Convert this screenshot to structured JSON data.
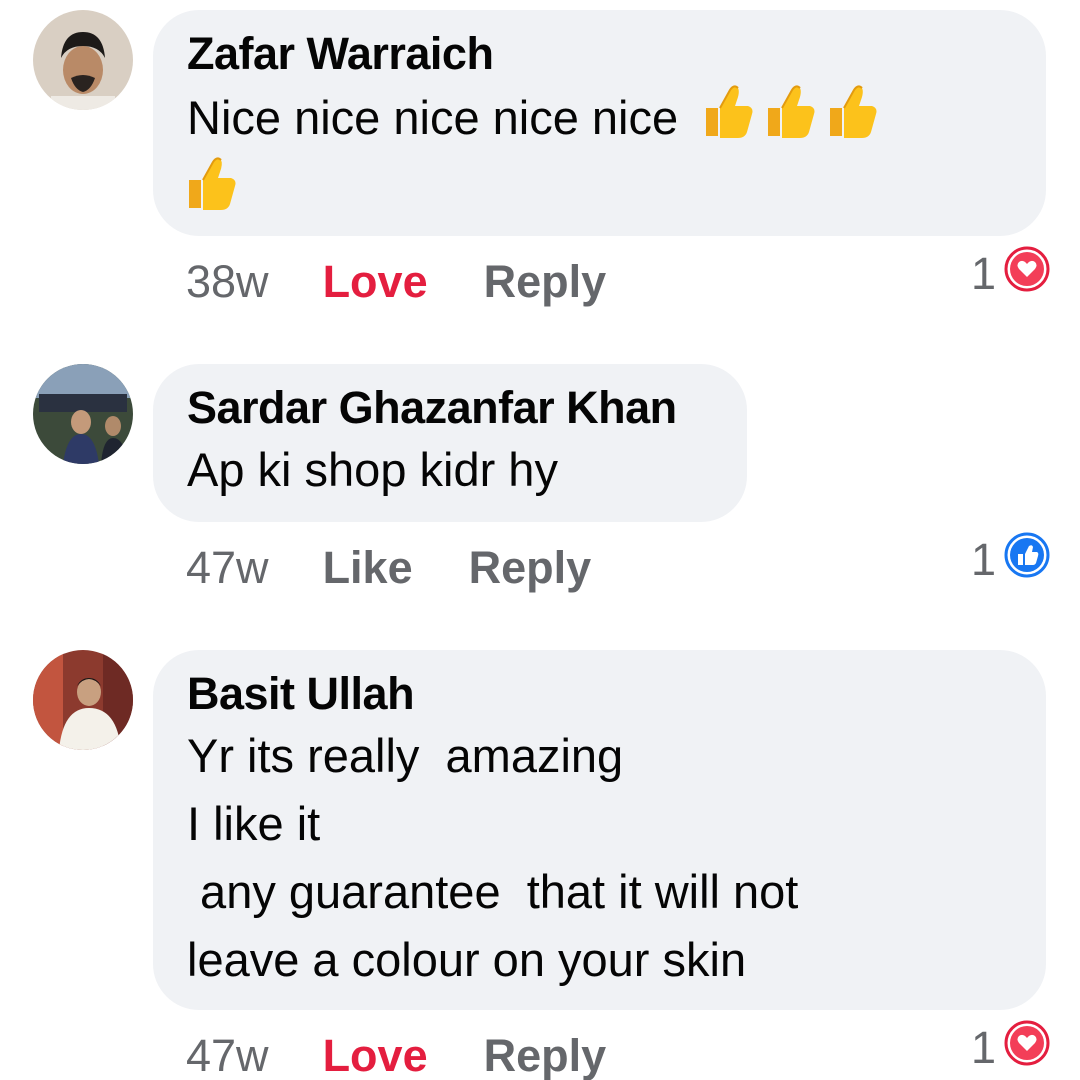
{
  "comments": [
    {
      "author": "Zafar Warraich",
      "text": "Nice nice nice nice nice",
      "emoji": [
        "thumbs-up",
        "thumbs-up",
        "thumbs-up",
        "thumbs-up"
      ],
      "time": "38w",
      "reaction_action": "Love",
      "reply": "Reply",
      "reaction_count": "1",
      "reaction_icon": "love-icon"
    },
    {
      "author": "Sardar Ghazanfar Khan",
      "text": "Ap ki shop kidr hy",
      "time": "47w",
      "reaction_action": "Like",
      "reply": "Reply",
      "reaction_count": "1",
      "reaction_icon": "like-icon"
    },
    {
      "author": "Basit Ullah",
      "lines": [
        "Yr its really  amazing",
        "I like it",
        " any guarantee  that it will not",
        "leave a colour on your skin"
      ],
      "time": "47w",
      "reaction_action": "Love",
      "reply": "Reply",
      "reaction_count": "1",
      "reaction_icon": "love-icon"
    }
  ],
  "colors": {
    "bubble": "#f0f2f5",
    "love": "#e41e3f",
    "like": "#1877f2",
    "meta": "#65676b",
    "text": "#050505"
  }
}
